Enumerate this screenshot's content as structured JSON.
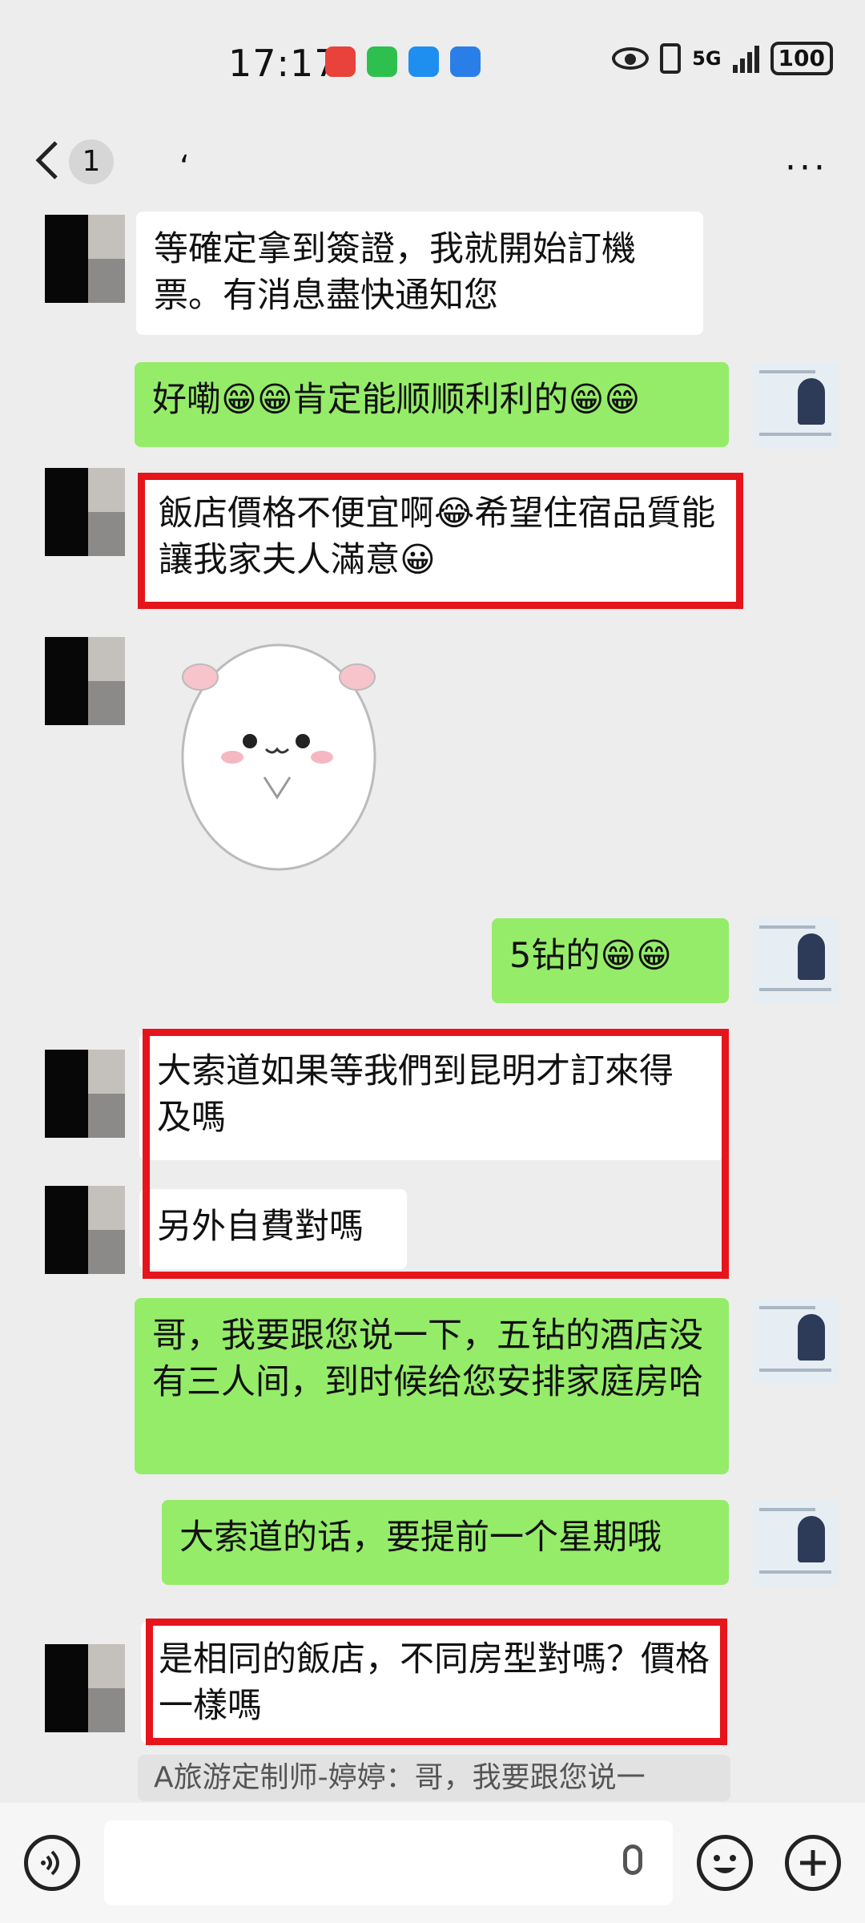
{
  "status_bar": {
    "time": "17:17",
    "network": "5G",
    "battery": "100"
  },
  "header": {
    "back_label": "<",
    "unread_count": "1",
    "title": "‘",
    "more_label": "···"
  },
  "messages": [
    {
      "from": "contact",
      "text": "等確定拿到簽證，我就開始訂機票。有消息盡快通知您"
    },
    {
      "from": "me",
      "text": "好嘞😁😁肯定能顺顺利利的😁😁"
    },
    {
      "from": "contact",
      "text": "飯店價格不便宜啊😂希望住宿品質能讓我家夫人滿意😀",
      "highlighted": true
    },
    {
      "from": "contact",
      "type": "sticker",
      "sticker": "white-hamster-praying"
    },
    {
      "from": "me",
      "text": "5钻的😁😁"
    },
    {
      "from": "contact",
      "text": "大索道如果等我們到昆明才訂來得及嗎",
      "highlighted": true
    },
    {
      "from": "contact",
      "text": "另外自費對嗎",
      "highlighted": true
    },
    {
      "from": "me",
      "text": "哥，我要跟您说一下，五钻的酒店没有三人间，到时候给您安排家庭房哈"
    },
    {
      "from": "me",
      "text": "大索道的话，要提前一个星期哦"
    },
    {
      "from": "contact",
      "text": "是相同的飯店，不同房型對嗎？價格一樣嗎",
      "highlighted": true
    }
  ],
  "quote_preview": "A旅游定制师-婷婷：哥，我要跟您说一",
  "input_bar": {
    "voice_icon": "voice-icon",
    "emoji_icon": "emoji-icon",
    "plus_icon": "plus-icon",
    "mic_icon": "mic-icon"
  },
  "colors": {
    "background": "#ededed",
    "outgoing_bubble": "#95ec69",
    "incoming_bubble": "#ffffff",
    "highlight_box": "#e6141b"
  }
}
